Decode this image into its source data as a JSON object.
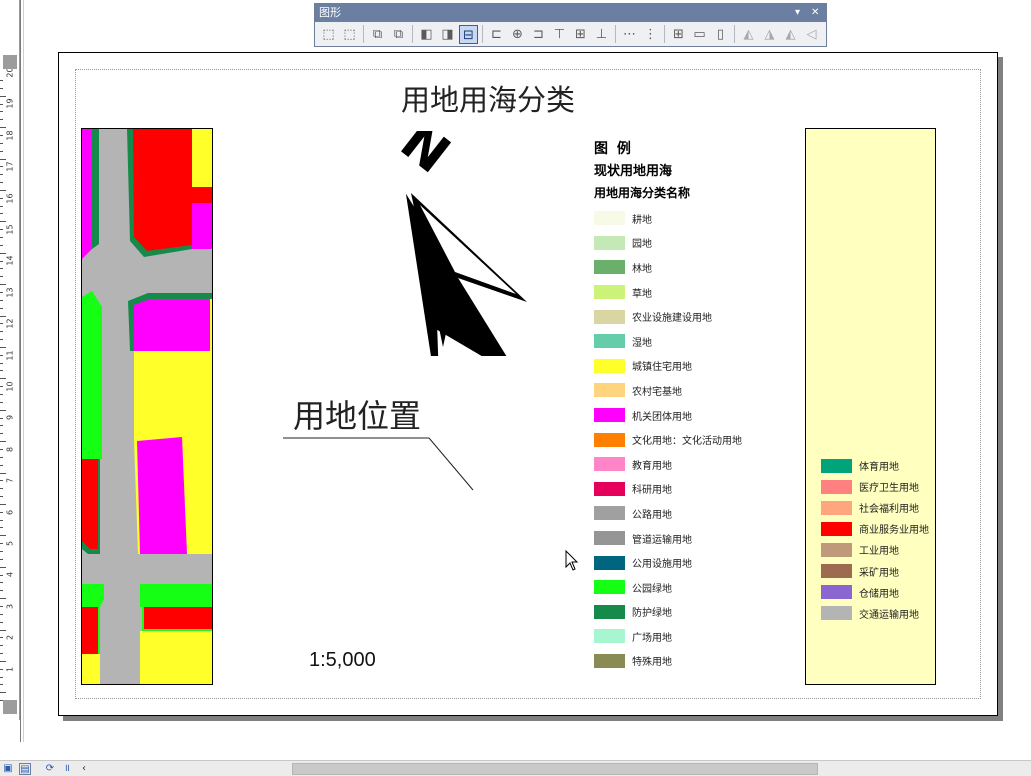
{
  "toolbar": {
    "title": "图形",
    "tools": [
      {
        "icon": "group-icon",
        "glyph": "⬚"
      },
      {
        "icon": "ungroup-icon",
        "glyph": "⬚"
      },
      {
        "icon": "bring-to-front-icon",
        "glyph": "⧉"
      },
      {
        "icon": "send-to-back-icon",
        "glyph": "⧉"
      },
      {
        "icon": "bring-forward-icon",
        "glyph": "◧"
      },
      {
        "icon": "send-backward-icon",
        "glyph": "◨"
      },
      {
        "icon": "align-to-margins-icon",
        "glyph": "⊟"
      },
      {
        "icon": "align-left-icon",
        "glyph": "⊏"
      },
      {
        "icon": "align-center-icon",
        "glyph": "⊕"
      },
      {
        "icon": "align-right-icon",
        "glyph": "⊐"
      },
      {
        "icon": "align-top-icon",
        "glyph": "⊤"
      },
      {
        "icon": "align-middle-icon",
        "glyph": "⊞"
      },
      {
        "icon": "align-bottom-icon",
        "glyph": "⊥"
      },
      {
        "icon": "distribute-horizontal-icon",
        "glyph": "⋯"
      },
      {
        "icon": "distribute-vertical-icon",
        "glyph": "⋮"
      },
      {
        "icon": "make-same-size-icon",
        "glyph": "⊞"
      },
      {
        "icon": "make-same-width-icon",
        "glyph": "▭"
      },
      {
        "icon": "make-same-height-icon",
        "glyph": "▯"
      },
      {
        "icon": "rotate-left-icon",
        "glyph": "◭"
      },
      {
        "icon": "rotate-right-icon",
        "glyph": "◮"
      },
      {
        "icon": "flip-horizontal-icon",
        "glyph": "◭"
      },
      {
        "icon": "flip-vertical-icon",
        "glyph": "◁"
      }
    ]
  },
  "page": {
    "map_title": "用地用海分类",
    "site_label": "用地位置",
    "scale_text": "1:5,000"
  },
  "legend": {
    "title": "图 例",
    "subtitle": "现状用地用海",
    "field_name": "用地用海分类名称",
    "items": [
      {
        "label": "耕地",
        "color": "#f7fae6"
      },
      {
        "label": "园地",
        "color": "#c5e8b7"
      },
      {
        "label": "林地",
        "color": "#6aaf6a"
      },
      {
        "label": "草地",
        "color": "#ccf27a"
      },
      {
        "label": "农业设施建设用地",
        "color": "#d9d6a3"
      },
      {
        "label": "湿地",
        "color": "#66cdaa"
      },
      {
        "label": "城镇住宅用地",
        "color": "#ffff2a"
      },
      {
        "label": "农村宅基地",
        "color": "#ffd47f"
      },
      {
        "label": "机关团体用地",
        "color": "#ff00ff"
      },
      {
        "label": "文化用地：文化活动用地",
        "color": "#ff7f00"
      },
      {
        "label": "教育用地",
        "color": "#ff85c9"
      },
      {
        "label": "科研用地",
        "color": "#e6005c"
      },
      {
        "label": "公路用地",
        "color": "#a0a0a0"
      },
      {
        "label": "管道运输用地",
        "color": "#959595"
      },
      {
        "label": "公用设施用地",
        "color": "#006680"
      },
      {
        "label": "公园绿地",
        "color": "#14ff14"
      },
      {
        "label": "防护绿地",
        "color": "#168a4b"
      },
      {
        "label": "广场用地",
        "color": "#a8f5d2"
      },
      {
        "label": "特殊用地",
        "color": "#8a8a55"
      }
    ]
  },
  "legend2": {
    "items": [
      {
        "label": "体育用地",
        "color": "#00a37a"
      },
      {
        "label": "医疗卫生用地",
        "color": "#ff8080"
      },
      {
        "label": "社会福利用地",
        "color": "#ffa67f"
      },
      {
        "label": "商业服务业用地",
        "color": "#ff0000"
      },
      {
        "label": "工业用地",
        "color": "#bf9a7a"
      },
      {
        "label": "采矿用地",
        "color": "#9c6b50"
      },
      {
        "label": "仓储用地",
        "color": "#8a66d0"
      },
      {
        "label": "交通运输用地",
        "color": "#b4b4b4"
      }
    ]
  },
  "ruler": {
    "labels": [
      "20",
      "19",
      "18",
      "17",
      "16",
      "15",
      "14",
      "13",
      "12",
      "11",
      "10",
      "9",
      "8",
      "7",
      "6",
      "5",
      "4",
      "3",
      "2",
      "1"
    ]
  },
  "bottombar": {
    "icons": [
      "layout-view-icon",
      "data-view-icon",
      "refresh-icon",
      "pause-icon",
      "scroll-left-icon"
    ]
  }
}
